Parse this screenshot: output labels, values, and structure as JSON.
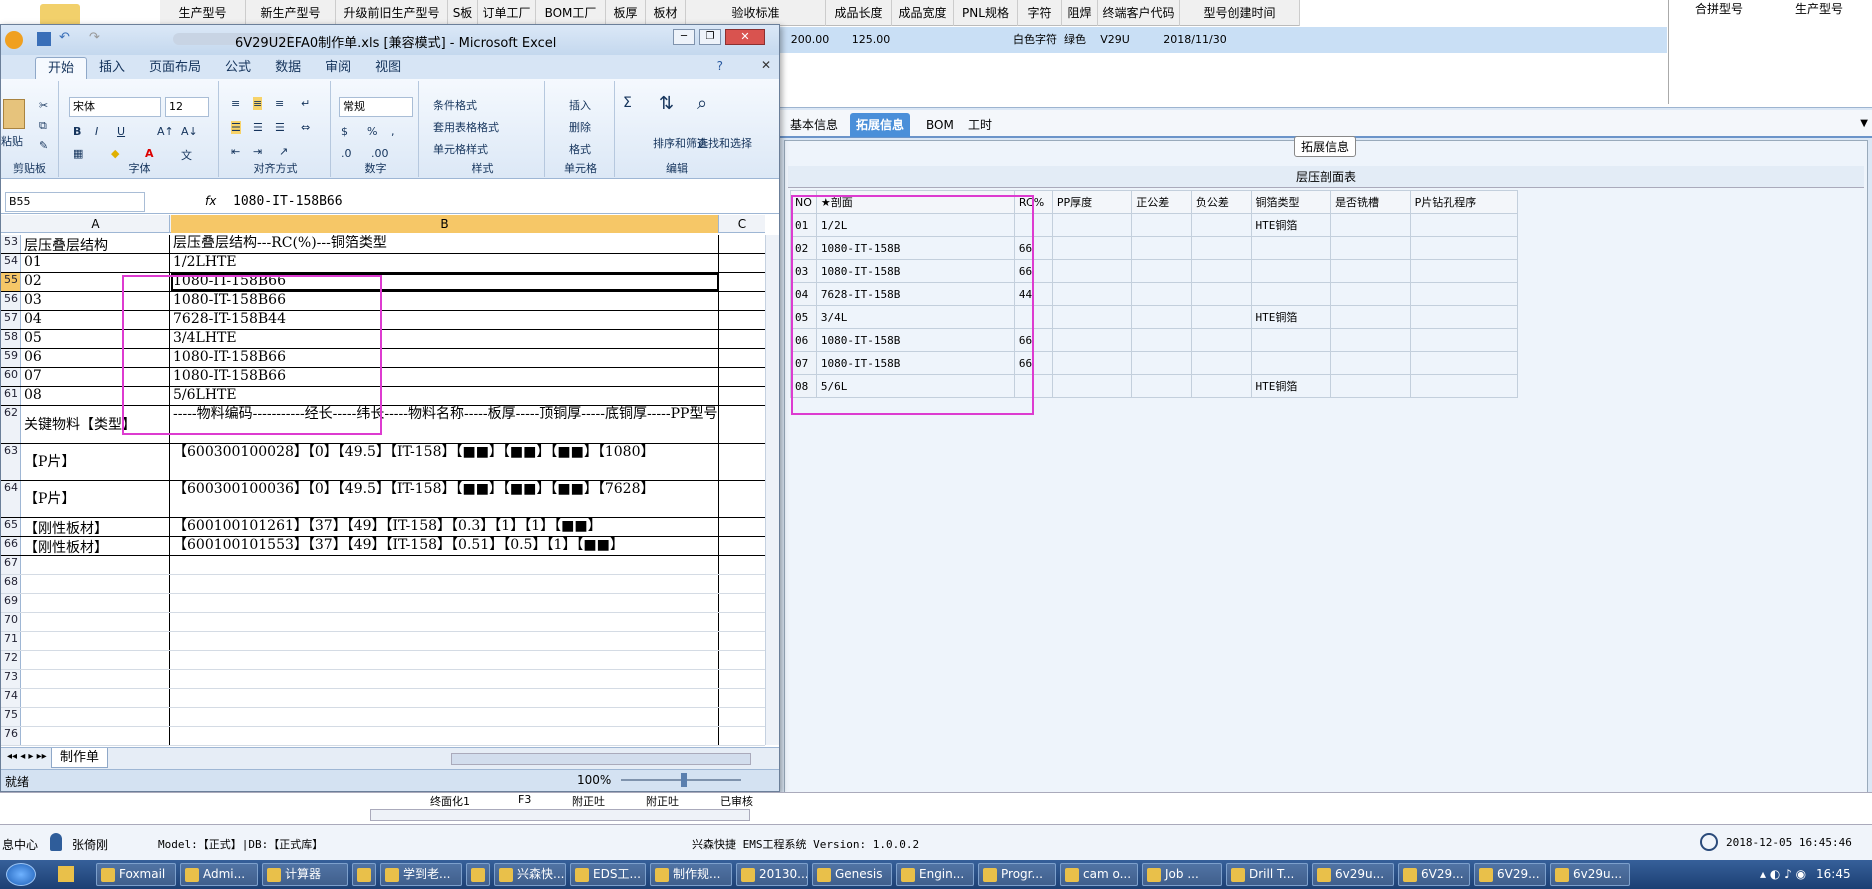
{
  "bg_app": {
    "headers": [
      "生产型号",
      "新生产型号",
      "升级前旧生产型号",
      "S板",
      "订单工厂",
      "BOM工厂",
      "板厚",
      "板材",
      "验收标准",
      "成品长度",
      "成品宽度",
      "PNL规格",
      "字符",
      "阻焊",
      "终端客户代码",
      "型号创建时间"
    ],
    "row": [
      "200.00",
      "125.00",
      "白色字符",
      "绿色",
      "V29U",
      "2018/11/30"
    ],
    "right_headers": [
      "合拼型号",
      "生产型号"
    ],
    "tabs": [
      "基本信息",
      "拓展信息",
      "BOM",
      "工时"
    ],
    "active_tab": "拓展信息",
    "group_legend": "拓展信息",
    "lam_title": "层压剖面表",
    "lam_headers": [
      "NO",
      "★剖面",
      "RC%",
      "PP厚度",
      "正公差",
      "负公差",
      "铜箔类型",
      "是否铣槽",
      "P片钻孔程序"
    ],
    "lam_rows": [
      {
        "no": "01",
        "section": "1/2L",
        "rc": "",
        "cu": "HTE铜箔"
      },
      {
        "no": "02",
        "section": "1080-IT-158B",
        "rc": "66",
        "cu": ""
      },
      {
        "no": "03",
        "section": "1080-IT-158B",
        "rc": "66",
        "cu": ""
      },
      {
        "no": "04",
        "section": "7628-IT-158B",
        "rc": "44",
        "cu": ""
      },
      {
        "no": "05",
        "section": "3/4L",
        "rc": "",
        "cu": "HTE铜箔"
      },
      {
        "no": "06",
        "section": "1080-IT-158B",
        "rc": "66",
        "cu": ""
      },
      {
        "no": "07",
        "section": "1080-IT-158B",
        "rc": "66",
        "cu": ""
      },
      {
        "no": "08",
        "section": "5/6L",
        "rc": "",
        "cu": "HTE铜箔"
      }
    ],
    "bottom_cols": [
      "终面化1",
      "F3",
      "附正吐",
      "附正吐",
      "已审核"
    ],
    "status_left": "息中心",
    "user": "张倚刚",
    "model_text": "Model:【正式】|DB:【正式库】",
    "system_text": "兴森快捷 EMS工程系统 Version: 1.0.0.2",
    "datetime": "2018-12-05 16:45:46"
  },
  "excel": {
    "title": "6V29U2EFA0制作单.xls  [兼容模式] - Microsoft Excel",
    "ribbon_tabs": [
      "开始",
      "插入",
      "页面布局",
      "公式",
      "数据",
      "审阅",
      "视图"
    ],
    "active_ribbon_tab": "开始",
    "paste_label": "粘贴",
    "font_name": "宋体",
    "font_size": "12",
    "number_format": "常规",
    "cond_format": "条件格式",
    "table_format": "套用表格格式",
    "cell_style": "单元格样式",
    "insert": "插入",
    "delete": "删除",
    "format": "格式",
    "sort_filter": "排序和筛选",
    "find_select": "查找和选择",
    "groups": [
      "剪贴板",
      "字体",
      "对齐方式",
      "数字",
      "样式",
      "单元格",
      "编辑"
    ],
    "name_box": "B55",
    "formula": "1080-IT-158B66",
    "col_a": "A",
    "col_b": "B",
    "col_c": "C",
    "rows": [
      {
        "n": "53",
        "a": "层压叠层结构",
        "b": "层压叠层结构---RC(%)---铜箔类型"
      },
      {
        "n": "54",
        "a": "01",
        "b": "1/2LHTE"
      },
      {
        "n": "55",
        "a": "02",
        "b": "1080-IT-158B66"
      },
      {
        "n": "56",
        "a": "03",
        "b": "1080-IT-158B66"
      },
      {
        "n": "57",
        "a": "04",
        "b": "7628-IT-158B44"
      },
      {
        "n": "58",
        "a": "05",
        "b": "3/4LHTE"
      },
      {
        "n": "59",
        "a": "06",
        "b": "1080-IT-158B66"
      },
      {
        "n": "60",
        "a": "07",
        "b": "1080-IT-158B66"
      },
      {
        "n": "61",
        "a": "08",
        "b": "5/6LHTE"
      },
      {
        "n": "62",
        "a": "关键物料【类型】",
        "b": "-----物料编码-----------经长-----纬长-----物料名称-----板厚-----顶铜厚-----底铜厚-----PP型号"
      },
      {
        "n": "63",
        "a": "【P片】",
        "b": "【600300100028】【0】【49.5】【IT-158】【■■】【■■】【■■】【1080】"
      },
      {
        "n": "64",
        "a": "【P片】",
        "b": "【600300100036】【0】【49.5】【IT-158】【■■】【■■】【■■】【7628】"
      },
      {
        "n": "65",
        "a": "【刚性板材】",
        "b": "【600100101261】【37】【49】【IT-158】【0.3】【1】【1】【■■】"
      },
      {
        "n": "66",
        "a": "【刚性板材】",
        "b": "【600100101553】【37】【49】【IT-158】【0.51】【0.5】【1】【■■】"
      },
      {
        "n": "67",
        "a": "",
        "b": ""
      },
      {
        "n": "68",
        "a": "",
        "b": ""
      },
      {
        "n": "69",
        "a": "",
        "b": ""
      },
      {
        "n": "70",
        "a": "",
        "b": ""
      },
      {
        "n": "71",
        "a": "",
        "b": ""
      },
      {
        "n": "72",
        "a": "",
        "b": ""
      },
      {
        "n": "73",
        "a": "",
        "b": ""
      },
      {
        "n": "74",
        "a": "",
        "b": ""
      },
      {
        "n": "75",
        "a": "",
        "b": ""
      },
      {
        "n": "76",
        "a": "",
        "b": ""
      }
    ],
    "sheet_tab": "制作单",
    "status_ready": "就绪",
    "zoom": "100%"
  },
  "taskbar": [
    "Foxmail",
    "Admi...",
    "计算器",
    "",
    "学到老...",
    "",
    "兴森快...",
    "EDS工...",
    "制作规...",
    "20130...",
    "Genesis",
    "Engin...",
    "Progr...",
    "cam o...",
    "Job ...",
    "Drill T...",
    "6v29u...",
    "6V29...",
    "6V29...",
    "6v29u..."
  ],
  "clock": "16:45"
}
